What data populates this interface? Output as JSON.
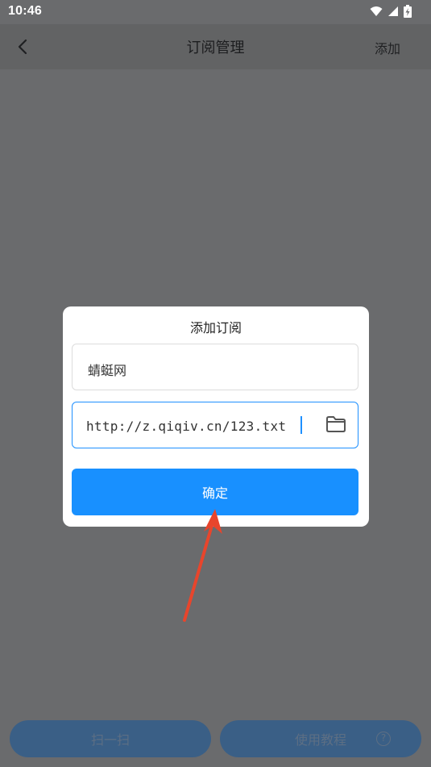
{
  "status_bar": {
    "time": "10:46",
    "icons": [
      "wifi-icon",
      "signal-icon",
      "battery-charging-icon"
    ]
  },
  "header": {
    "title": "订阅管理",
    "back_icon": "chevron-left-icon",
    "add_label": "添加"
  },
  "dialog": {
    "title": "添加订阅",
    "name_value": "蜻蜓网",
    "url_value": "http://z.qiqiv.cn/123.txt",
    "folder_icon": "folder-icon",
    "confirm_label": "确定"
  },
  "bottom_bar": {
    "scan_label": "扫一扫",
    "help_label": "使用教程",
    "help_icon": "question-circle-icon",
    "help_glyph": "?"
  },
  "colors": {
    "accent": "#1890ff",
    "overlay": "#6a6b6d",
    "arrow": "#e8452c"
  }
}
